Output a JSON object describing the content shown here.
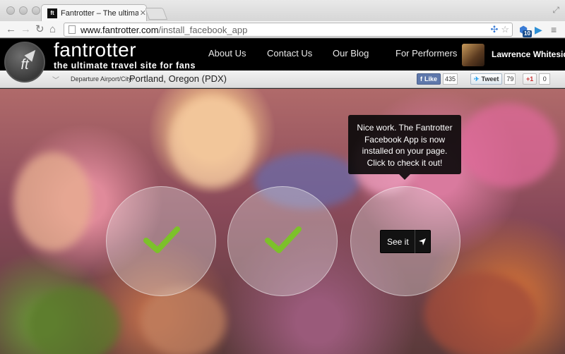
{
  "browser": {
    "tab_title": "Fantrotter – The ultimate t",
    "tab_favicon": "ft",
    "url_domain": "www.fantrotter.com",
    "url_path": "/install_facebook_app",
    "extension_badge": "10"
  },
  "site": {
    "brand": "fantrotter",
    "tagline": "the ultimate travel site for fans",
    "logo_text": "ft",
    "nav": [
      {
        "label": "About Us"
      },
      {
        "label": "Contact Us"
      },
      {
        "label": "Our Blog"
      },
      {
        "label": "For Performers"
      }
    ],
    "user_name": "Lawrence Whiteside"
  },
  "subbar": {
    "departure_label": "Departure Airport/City:",
    "departure_value": "Portland, Oregon (PDX)",
    "facebook": {
      "label": "Like",
      "count": "435"
    },
    "twitter": {
      "label": "Tweet",
      "count": "79"
    },
    "gplus": {
      "label": "+1",
      "count": "0"
    }
  },
  "hero": {
    "tooltip": "Nice work. The Fantrotter Facebook App is now installed on your page. Click to check it out!",
    "see_it_label": "See it",
    "check_color": "#7cc12a"
  }
}
